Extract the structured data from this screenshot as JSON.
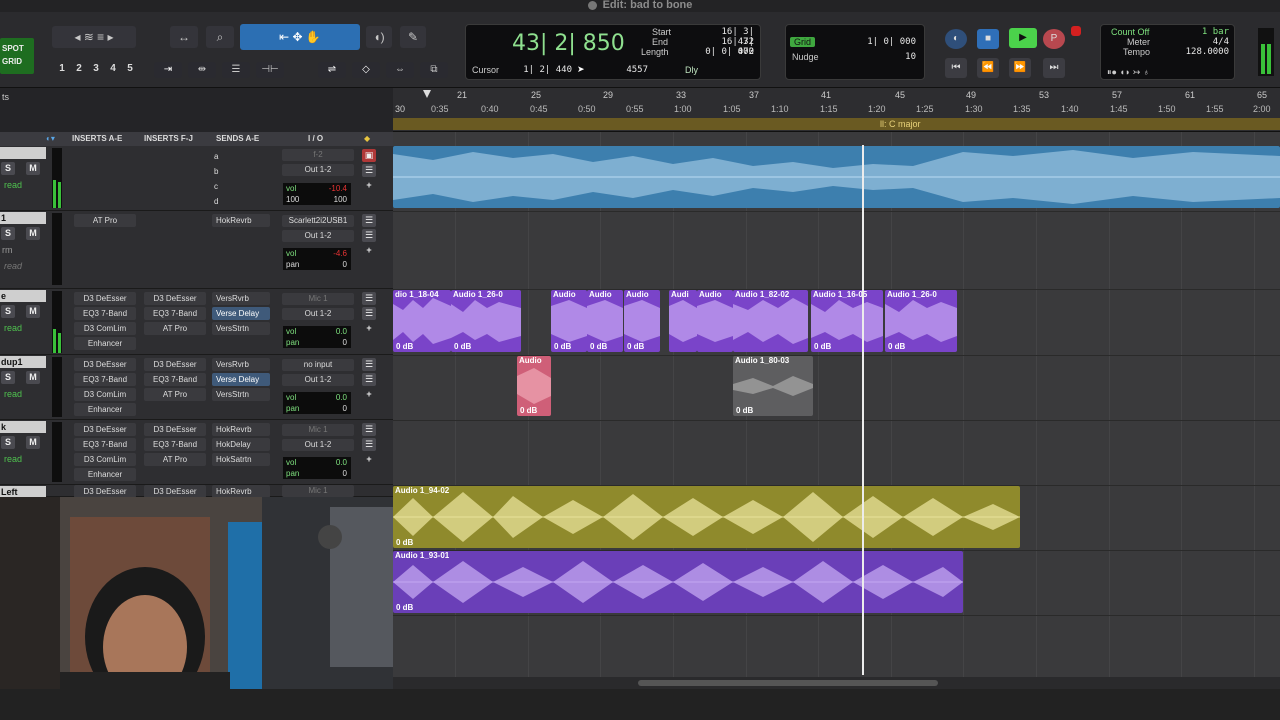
{
  "window": {
    "title": "Edit: bad to bone"
  },
  "toolbar": {
    "mode": [
      "SPOT",
      "GRID"
    ],
    "zoom_presets": [
      "1",
      "2",
      "3",
      "4",
      "5"
    ]
  },
  "counter": {
    "main": "43| 2| 850",
    "start_label": "Start",
    "start": "16| 3| 472",
    "end_label": "End",
    "end": "16| 3| 472",
    "length_label": "Length",
    "length": "0| 0| 000",
    "cursor_label": "Cursor",
    "cursor": "1| 2| 440",
    "samples": "4557",
    "dly": "Dly"
  },
  "grid": {
    "grid_label": "Grid",
    "grid_value": "1| 0| 000",
    "nudge_label": "Nudge",
    "nudge_value": "10"
  },
  "countoff": {
    "count_off": "Count Off",
    "bars": "1 bar",
    "meter_label": "Meter",
    "meter": "4/4",
    "tempo_label": "Tempo",
    "tempo": "128.0000"
  },
  "ruler": {
    "bars": [
      "21",
      "25",
      "29",
      "33",
      "37",
      "41",
      "45",
      "49",
      "53",
      "57",
      "61",
      "65"
    ],
    "bar_left": "30",
    "times": [
      "0:35",
      "0:40",
      "0:45",
      "0:50",
      "0:55",
      "1:00",
      "1:05",
      "1:10",
      "1:15",
      "1:20",
      "1:25",
      "1:30",
      "1:35",
      "1:40",
      "1:45",
      "1:50",
      "1:55",
      "2:00"
    ],
    "key": "ll: C major",
    "left_label": "ts"
  },
  "mix_headers": {
    "inserts_ae": "INSERTS A-E",
    "inserts_fj": "INSERTS F-J",
    "sends_ae": "SENDS A-E",
    "io": "I / O"
  },
  "tracks": [
    {
      "name": "",
      "ins1": [],
      "ins2": [],
      "sends": [],
      "io": "f-2",
      "out": "Out 1-2",
      "vol": "-10.4",
      "pan_l": "100",
      "pan_r": "100"
    },
    {
      "name": "1",
      "ins1": [
        "AT Pro"
      ],
      "ins2": [],
      "sends": [
        "HokRevrb"
      ],
      "io": "Scarlett2i2USB1",
      "out": "Out 1-2",
      "vol": "-4.6",
      "pan": "0"
    },
    {
      "name": "e",
      "ins1": [
        "D3 DeEsser",
        "EQ3 7-Band",
        "D3 ComLim",
        "Enhancer"
      ],
      "ins2": [
        "D3 DeEsser",
        "EQ3 7-Band",
        "AT Pro"
      ],
      "sends": [
        "VersRvrb",
        "Verse Delay",
        "VersStrtn"
      ],
      "io": "Mic 1",
      "out": "Out 1-2",
      "vol": "0.0",
      "pan": "0"
    },
    {
      "name": "dup1",
      "ins1": [
        "D3 DeEsser",
        "EQ3 7-Band",
        "D3 ComLim",
        "Enhancer"
      ],
      "ins2": [
        "D3 DeEsser",
        "EQ3 7-Band",
        "AT Pro"
      ],
      "sends": [
        "VersRvrb",
        "Verse Delay",
        "VersStrtn"
      ],
      "io": "no input",
      "out": "Out 1-2",
      "vol": "0.0",
      "pan": "0"
    },
    {
      "name": "k",
      "ins1": [
        "D3 DeEsser",
        "EQ3 7-Band",
        "D3 ComLim",
        "Enhancer"
      ],
      "ins2": [
        "D3 DeEsser",
        "EQ3 7-Band",
        "AT Pro"
      ],
      "sends": [
        "HokRevrb",
        "HokDelay",
        "HokSatrtn"
      ],
      "io": "Mic 1",
      "out": "Out 1-2",
      "vol": "0.0",
      "pan": "0"
    },
    {
      "name": "Left",
      "ins1": [
        "D3 DeEsser"
      ],
      "ins2": [
        "D3 DeEsser"
      ],
      "sends": [
        "HokRevrb"
      ],
      "io": "Mic 1"
    }
  ],
  "track_labels": {
    "s": "S",
    "m": "M",
    "read": "read",
    "vol": "vol",
    "pan": "pan",
    "send_letters": [
      "a",
      "b",
      "c",
      "d"
    ],
    "rm": "rm"
  },
  "clips": {
    "lane3": [
      {
        "name": "dio 1_18-04",
        "db": "0 dB"
      },
      {
        "name": "Audio 1_26-0",
        "db": "0 dB"
      },
      {
        "name": "Audio",
        "db": "0 dB"
      },
      {
        "name": "Audio",
        "db": "0 dB"
      },
      {
        "name": "Audio",
        "db": "0 dB"
      },
      {
        "name": "Audi",
        "db": ""
      },
      {
        "name": "Audio",
        "db": ""
      },
      {
        "name": "Audio 1_82-02",
        "db": ""
      },
      {
        "name": "Audio 1_16-05",
        "db": "0 dB"
      },
      {
        "name": "Audio 1_26-0",
        "db": "0 dB"
      }
    ],
    "lane4": [
      {
        "name": "Audio",
        "db": "0 dB"
      },
      {
        "name": "Audio 1_80-03",
        "db": "0 dB"
      }
    ],
    "lane6": {
      "name": "Audio 1_94-02",
      "db": "0 dB"
    },
    "lane7": {
      "name": "Audio 1_93-01",
      "db": "0 dB"
    }
  },
  "colors": {
    "blue_clip": "#4a98c8",
    "purple_clip": "#7a44c9",
    "pink_clip": "#d0607a",
    "gray_clip": "#6e6e6e",
    "yellow_clip": "#8f8a2c",
    "violet_clip": "#6a3fb8",
    "counter_green": "#8fe08f"
  }
}
